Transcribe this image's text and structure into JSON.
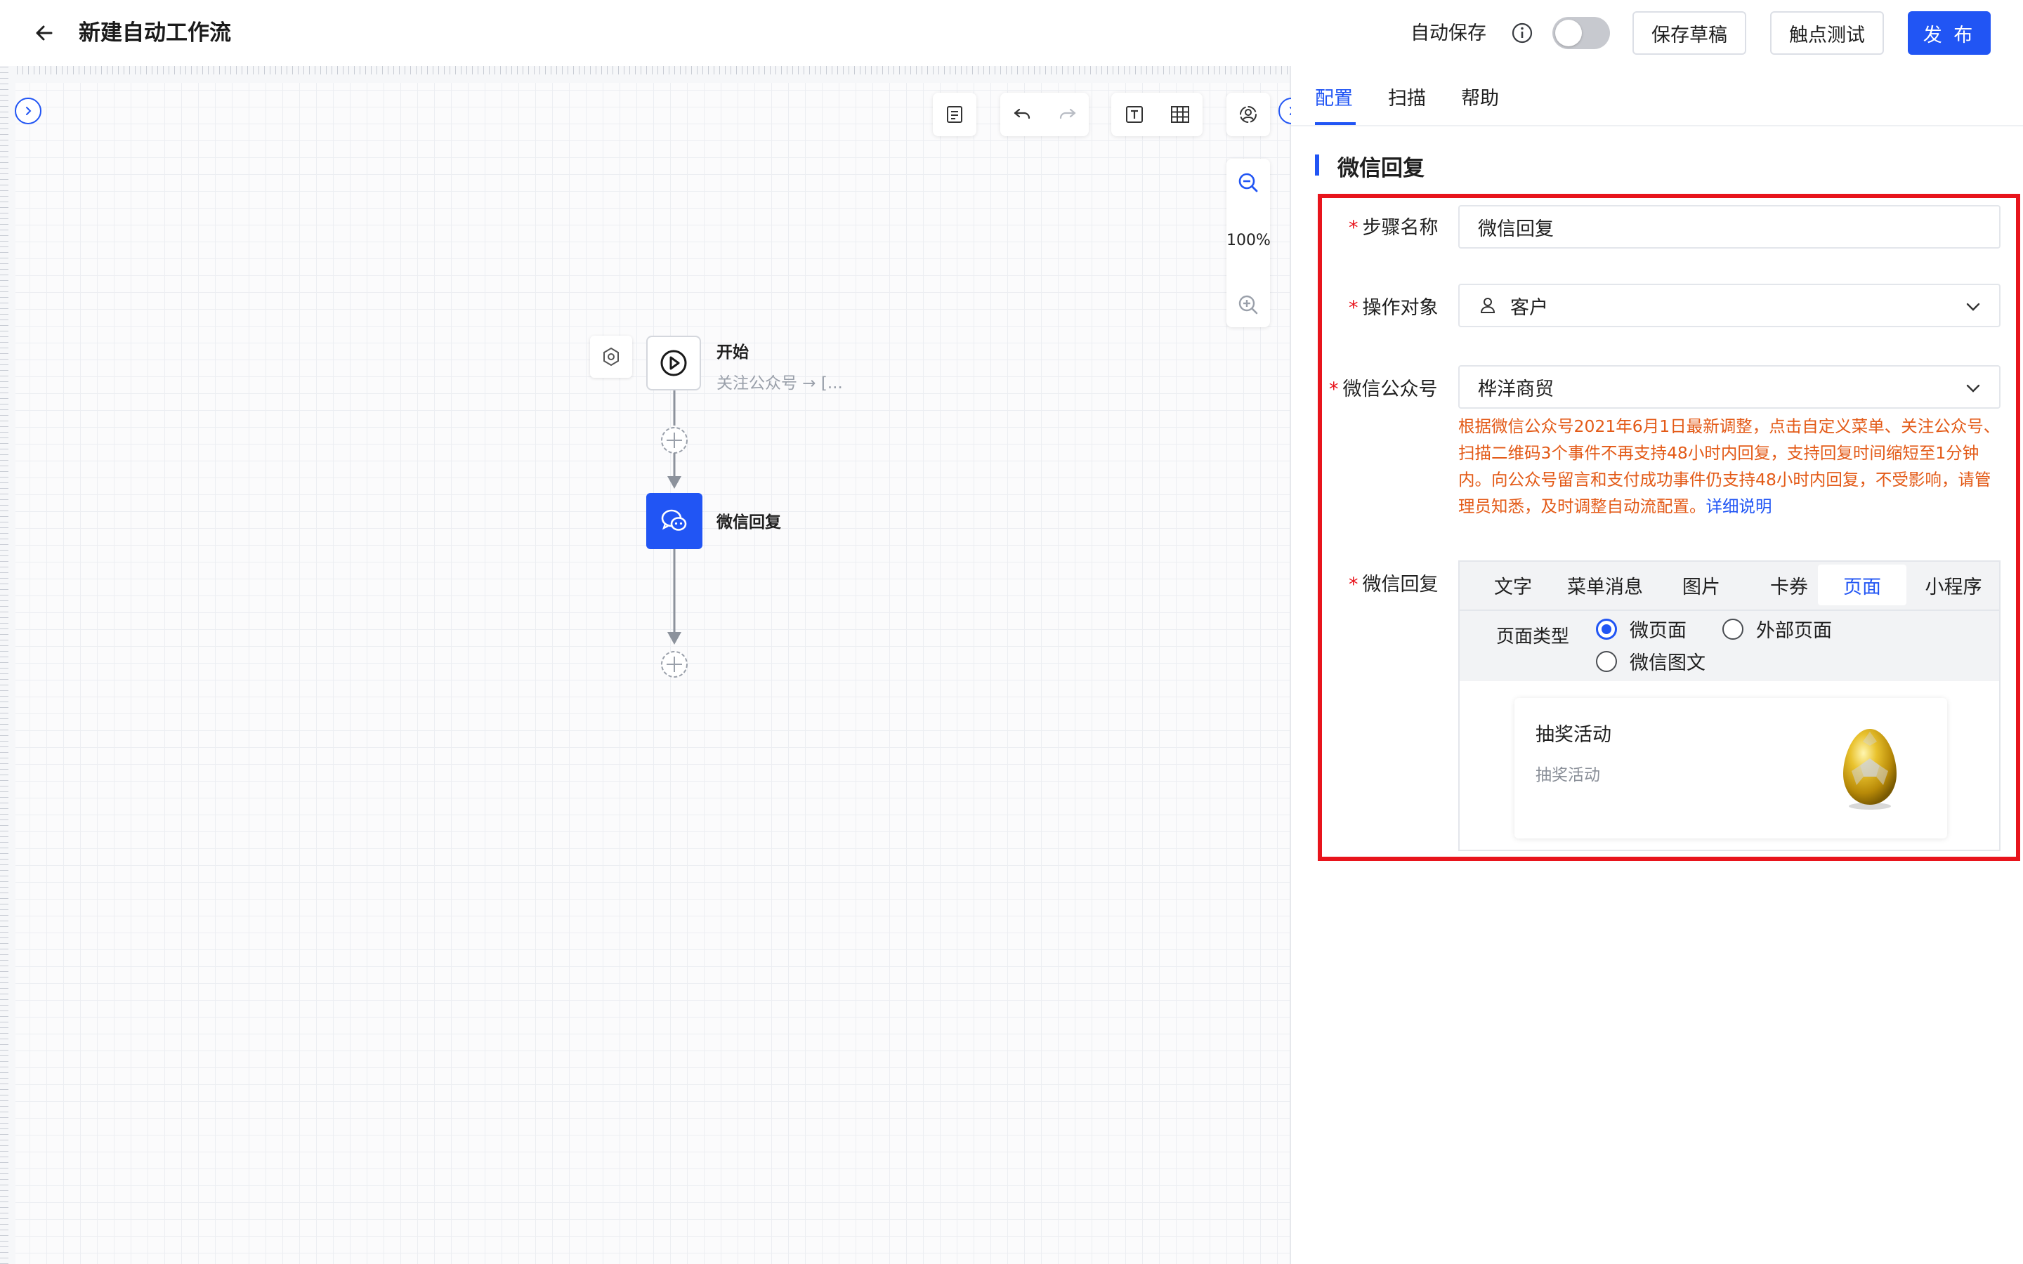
{
  "header": {
    "title": "新建自动工作流",
    "autosave_label": "自动保存",
    "save_draft": "保存草稿",
    "touch_test": "触点测试",
    "publish": "发 布"
  },
  "canvas": {
    "zoom": "100%",
    "nodes": {
      "start_title": "开始",
      "start_sub": "关注公众号 → [...",
      "wechat_title": "微信回复"
    }
  },
  "panel": {
    "tabs": [
      "配置",
      "扫描",
      "帮助"
    ],
    "section_title": "微信回复",
    "form": {
      "step_name_label": "步骤名称",
      "step_name_value": "微信回复",
      "target_label": "操作对象",
      "target_value": "客户",
      "account_label": "微信公众号",
      "account_value": "桦洋商贸",
      "warning": "根据微信公众号2021年6月1日最新调整，点击自定义菜单、关注公众号、扫描二维码3个事件不再支持48小时内回复，支持回复时间缩短至1分钟内。向公众号留言和支付成功事件仍支持48小时内回复，不受影响，请管理员知悉，及时调整自动流配置。",
      "warning_link": "详细说明",
      "reply_label": "微信回复",
      "reply_tabs": [
        "文字",
        "菜单消息",
        "图片",
        "卡券",
        "页面",
        "小程序"
      ],
      "page_type_label": "页面类型",
      "page_types": [
        "微页面",
        "外部页面",
        "微信图文"
      ],
      "selected_page_type": "微页面",
      "card_title": "抽奖活动",
      "card_sub": "抽奖活动"
    }
  },
  "colors": {
    "accent": "#2155f4",
    "highlight": "#e8141c",
    "warning": "#e35a17"
  }
}
